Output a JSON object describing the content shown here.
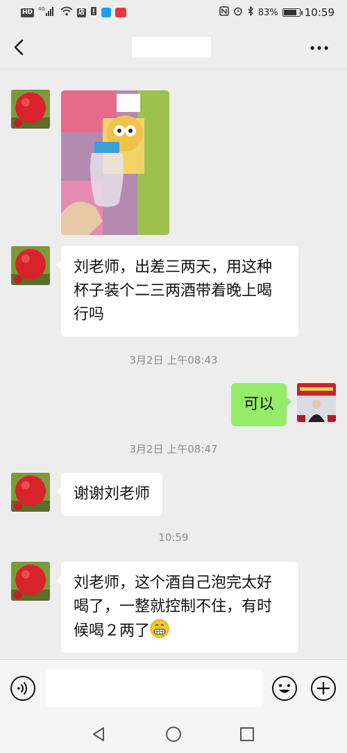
{
  "status_bar": {
    "left_badges": [
      "HD",
      "4G",
      "店"
    ],
    "battery_percent": "83%",
    "battery_level": 0.83,
    "time": "10:59"
  },
  "header": {
    "back_icon": "chevron-left-icon",
    "title": "",
    "more_icon": "more-horizontal-icon"
  },
  "messages": [
    {
      "sender": "other",
      "type": "image",
      "image_icon": "photo-baby-bottle"
    },
    {
      "sender": "other",
      "type": "text",
      "text": "刘老师，出差三两天，用这种杯子装个二三两酒带着晚上喝行吗"
    },
    {
      "type": "timestamp",
      "text": "3月2日 上午08:43"
    },
    {
      "sender": "self",
      "type": "text",
      "text": "可以"
    },
    {
      "type": "timestamp",
      "text": "3月2日 上午08:47"
    },
    {
      "sender": "other",
      "type": "text",
      "text": "谢谢刘老师"
    },
    {
      "type": "timestamp",
      "text": "10:59"
    },
    {
      "sender": "other",
      "type": "text",
      "text": "刘老师，这个酒自己泡完太好喝了，一整就控制不住，有时候喝２两了",
      "emoji": "grin-emoji"
    }
  ],
  "input_bar": {
    "voice_icon": "voice-icon",
    "input_value": "",
    "emoji_icon": "emoji-icon",
    "plus_icon": "plus-icon"
  },
  "system_nav": {
    "back_icon": "triangle-back-icon",
    "home_icon": "circle-home-icon",
    "recents_icon": "square-recents-icon"
  },
  "colors": {
    "background": "#ededed",
    "self_bubble": "#95ec69",
    "other_bubble": "#ffffff",
    "timestamp": "#8c8c8c"
  }
}
